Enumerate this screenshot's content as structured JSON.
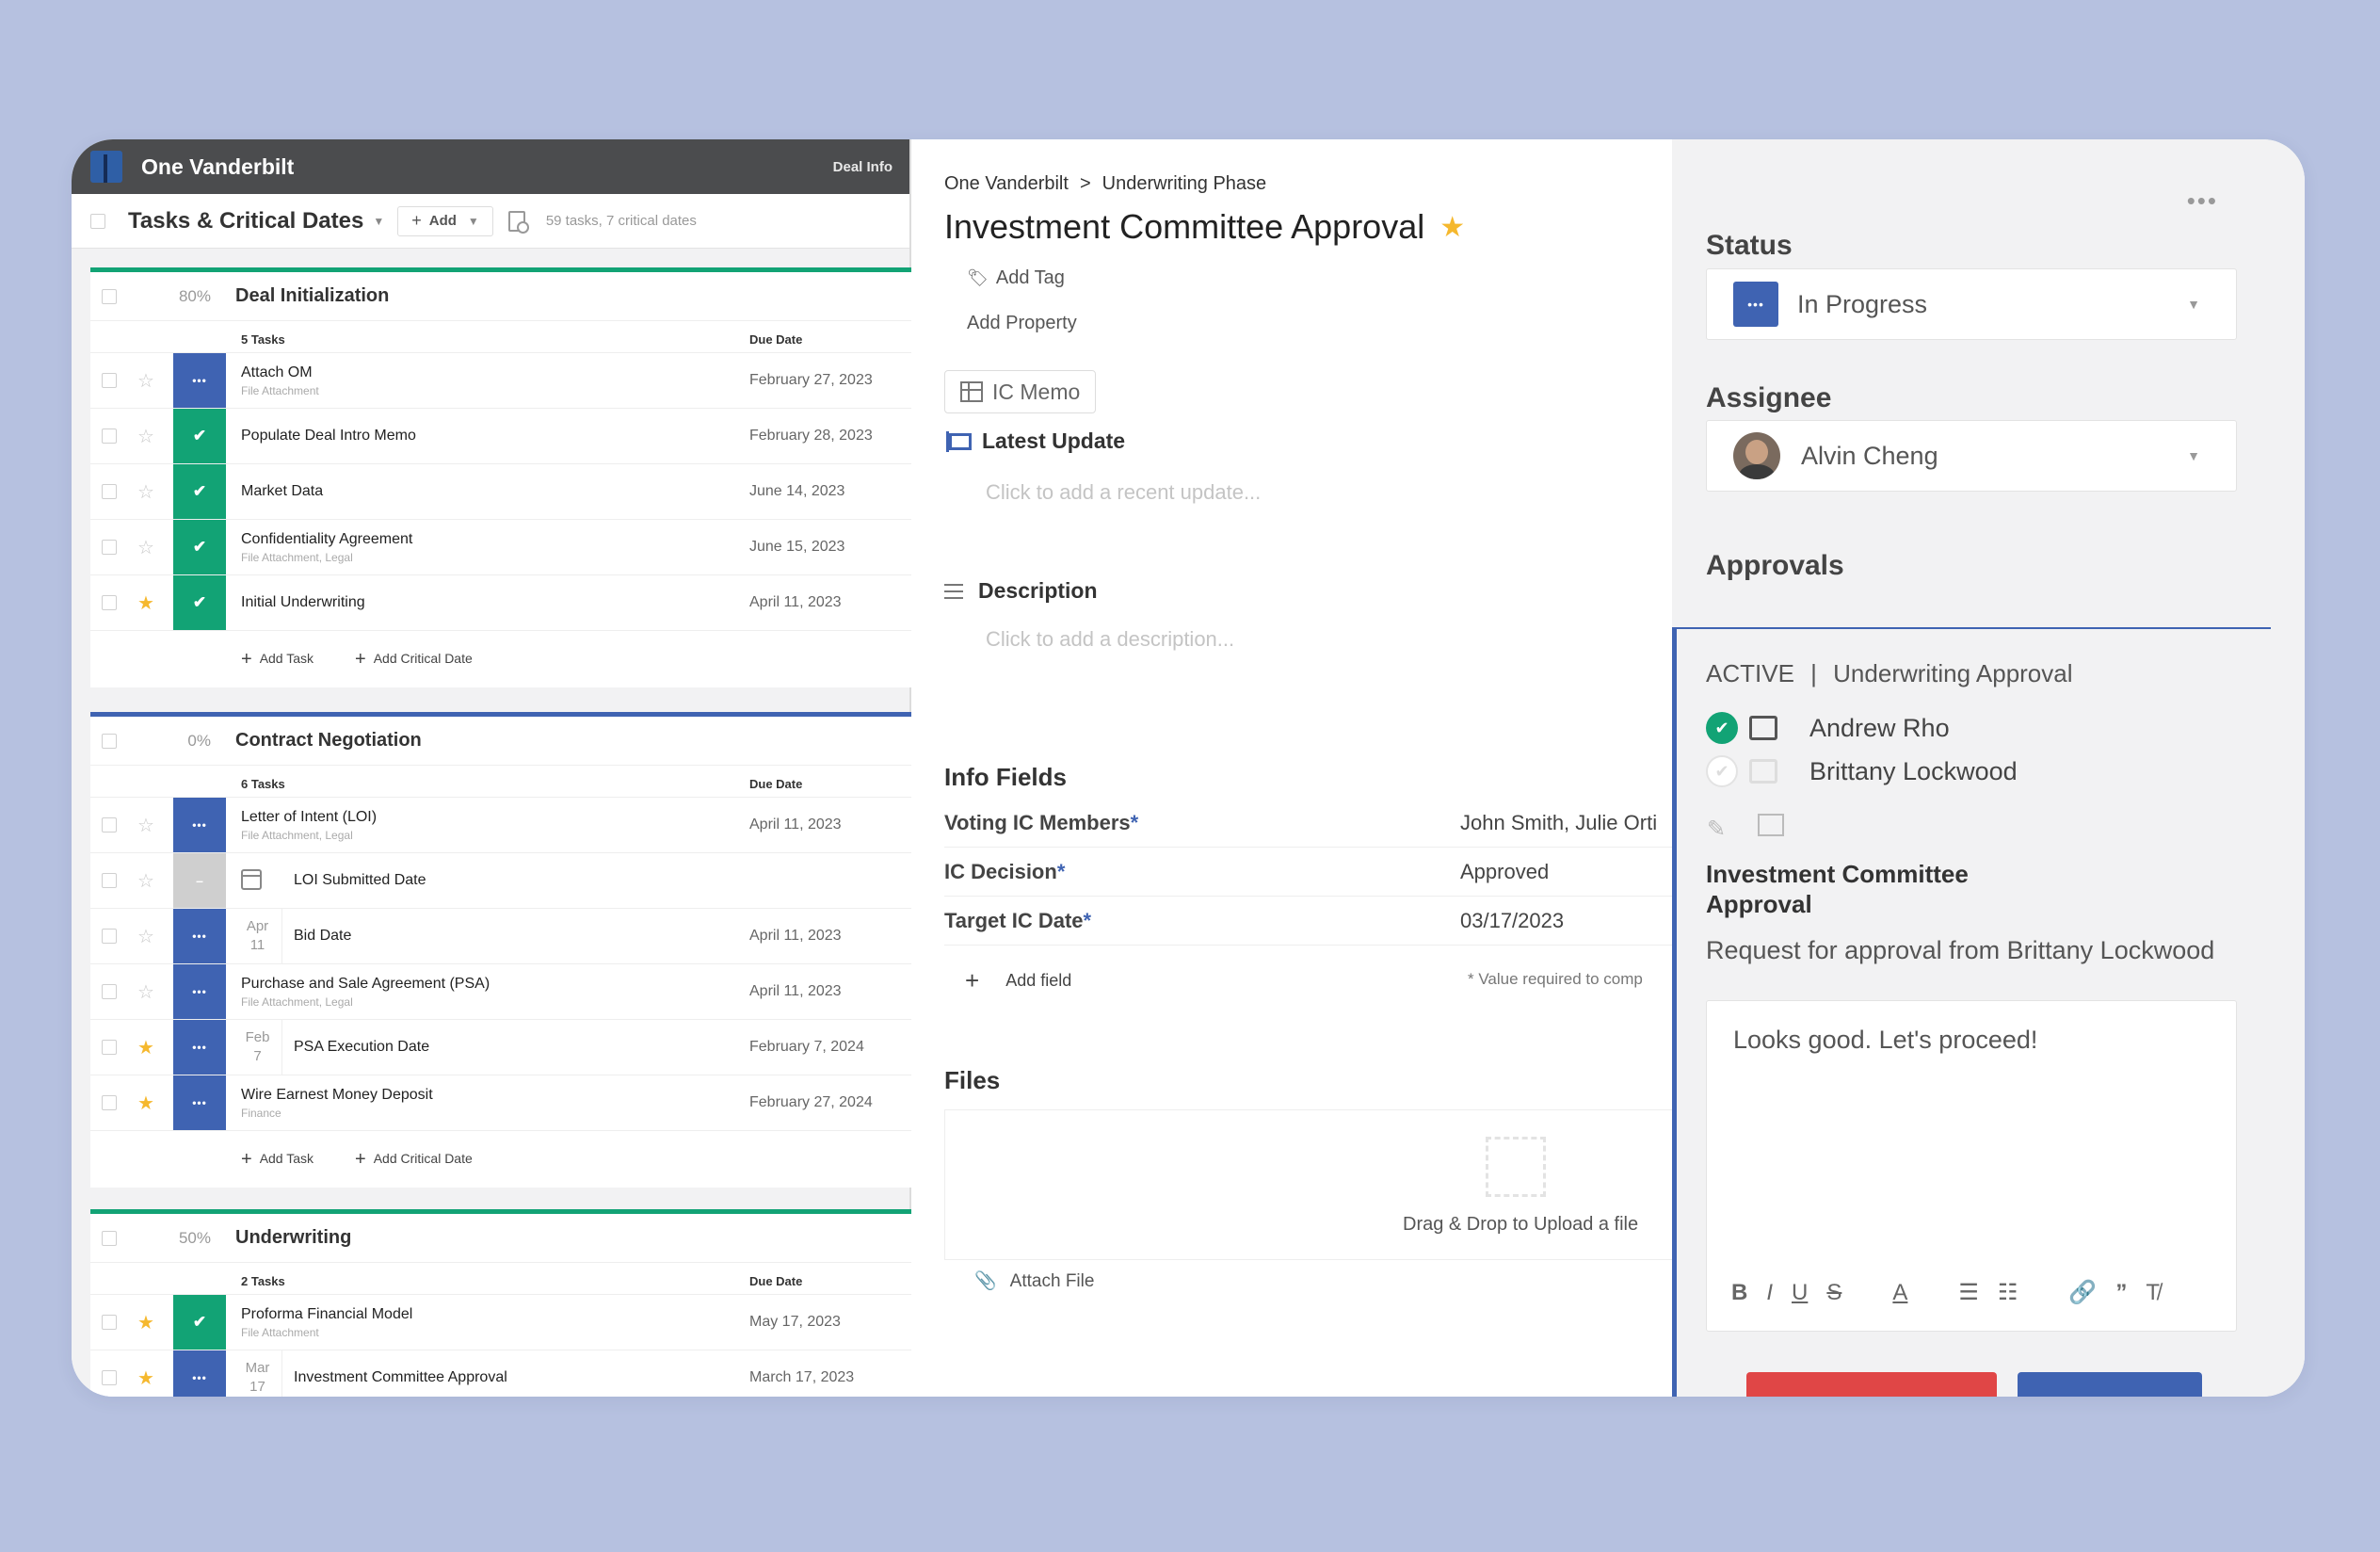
{
  "app": {
    "project": "One Vanderbilt",
    "deal_info": "Deal Info"
  },
  "tasks_bar": {
    "title": "Tasks & Critical Dates",
    "add_label": "Add",
    "count": "59 tasks, 7 critical dates"
  },
  "groups": [
    {
      "percent": "80%",
      "title": "Deal Initialization",
      "task_count": "5 Tasks",
      "due_header": "Due Date",
      "color": "#12a375",
      "rows": [
        {
          "name": "Attach OM",
          "sub": "File Attachment",
          "date": "February 27, 2023",
          "state": "blue",
          "starred": false
        },
        {
          "name": "Populate Deal Intro Memo",
          "sub": "",
          "date": "February 28, 2023",
          "state": "green",
          "starred": false
        },
        {
          "name": "Market Data",
          "sub": "",
          "date": "June 14, 2023",
          "state": "green",
          "starred": false
        },
        {
          "name": "Confidentiality Agreement",
          "sub": "File Attachment, Legal",
          "date": "June 15, 2023",
          "state": "green",
          "starred": false
        },
        {
          "name": "Initial Underwriting",
          "sub": "",
          "date": "April 11, 2023",
          "state": "green",
          "starred": true
        }
      ],
      "add_task": "Add Task",
      "add_critical": "Add Critical Date"
    },
    {
      "percent": "0%",
      "title": "Contract Negotiation",
      "task_count": "6 Tasks",
      "due_header": "Due Date",
      "color": "#3f63b2",
      "rows": [
        {
          "name": "Letter of Intent (LOI)",
          "sub": "File Attachment, Legal",
          "date": "April 11, 2023",
          "state": "blue",
          "starred": false
        },
        {
          "name": "LOI Submitted Date",
          "sub": "",
          "date": "",
          "state": "grey",
          "starred": false
        },
        {
          "name": "Bid Date",
          "sub": "",
          "date": "April 11, 2023",
          "state": "blue",
          "starred": false,
          "month": "Apr",
          "day": "11"
        },
        {
          "name": "Purchase and Sale Agreement (PSA)",
          "sub": "File Attachment, Legal",
          "date": "April 11, 2023",
          "state": "blue",
          "starred": false
        },
        {
          "name": "PSA Execution Date",
          "sub": "",
          "date": "February 7, 2024",
          "state": "blue",
          "starred": true,
          "month": "Feb",
          "day": "7"
        },
        {
          "name": "Wire Earnest Money Deposit",
          "sub": "Finance",
          "date": "February 27, 2024",
          "state": "blue",
          "starred": true
        }
      ],
      "add_task": "Add Task",
      "add_critical": "Add Critical Date"
    },
    {
      "percent": "50%",
      "title": "Underwriting",
      "task_count": "2 Tasks",
      "due_header": "Due Date",
      "color": "#12a375",
      "rows": [
        {
          "name": "Proforma Financial Model",
          "sub": "File Attachment",
          "date": "May 17, 2023",
          "state": "green",
          "starred": true
        },
        {
          "name": "Investment Committee Approval",
          "sub": "",
          "date": "March 17, 2023",
          "state": "blue",
          "starred": true,
          "month": "Mar",
          "day": "17"
        }
      ]
    }
  ],
  "detail": {
    "breadcrumb": {
      "project": "One Vanderbilt",
      "sep": ">",
      "phase": "Underwriting Phase"
    },
    "title": "Investment Committee Approval",
    "add_tag": "Add Tag",
    "add_property": "Add Property",
    "ic_memo": "IC Memo",
    "latest_update": {
      "label": "Latest Update",
      "placeholder": "Click to add a recent update..."
    },
    "description": {
      "label": "Description",
      "placeholder": "Click to add a description..."
    },
    "info_fields": {
      "label": "Info Fields",
      "rows": [
        {
          "label": "Voting IC Members",
          "req": "*",
          "value": "John Smith, Julie Orti"
        },
        {
          "label": "IC Decision",
          "req": "*",
          "value": "Approved"
        },
        {
          "label": "Target IC Date",
          "req": "*",
          "value": "03/17/2023"
        }
      ],
      "add_field": "Add field",
      "note": "* Value required to comp"
    },
    "files": {
      "label": "Files",
      "drop_text": "Drag & Drop to Upload a file",
      "attach": "Attach File"
    }
  },
  "side": {
    "status": {
      "label": "Status",
      "value": "In Progress"
    },
    "assignee": {
      "label": "Assignee",
      "value": "Alvin Cheng"
    },
    "approvals": {
      "label": "Approvals",
      "active": "ACTIVE",
      "sep": "|",
      "name": "Underwriting Approval",
      "approvers": [
        {
          "name": "Andrew Rho",
          "approved": true
        },
        {
          "name": "Brittany Lockwood",
          "approved": false
        }
      ],
      "item_title": "Investment Committee Approval",
      "request": "Request for approval from Brittany Lockwood",
      "comment": "Looks good. Let's proceed!"
    }
  },
  "colors": {
    "blue": "#3f63b2",
    "green": "#12a375",
    "star": "#f5b82e",
    "red": "#e04646"
  }
}
